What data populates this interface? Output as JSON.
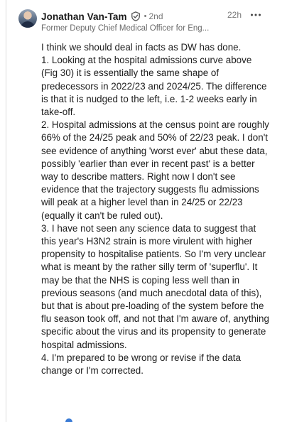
{
  "comment": {
    "author": "Jonathan Van-Tam",
    "verified_icon": "shield-check-icon",
    "connection_degree": "2nd",
    "separator": "•",
    "headline": "Former Deputy Chief Medical Officer for Eng...",
    "time": "22h",
    "more_icon": "three-dots-icon",
    "paragraphs": [
      "I think we should deal in facts as DW has done.",
      "1. Looking at the hospital admissions curve above (Fig 30) it is essentially the same shape of predecessors in 2022/23 and 2024/25. The difference is that it is nudged to the left, i.e. 1-2 weeks early in take-off.",
      "2. Hospital admissions at the census point are roughly 66% of the 24/25 peak and 50% of 22/23 peak. I don't see evidence of anything 'worst ever' abut these data, possibly 'earlier than ever in recent past' is a better way to describe matters. Right now I don't see evidence that the trajectory suggests flu admissions will peak at a higher level than in 24/25 or 22/23 (equally it can't be ruled out).",
      "3. I have not seen any science data to suggest that this year's H3N2 strain is more virulent with higher propensity to hospitalise patients. So I'm very unclear what is meant by the rather silly term of 'superflu'. It may be that the NHS is coping less well than in previous seasons (and much anecdotal data of this), but that is about pre-loading of the system before the flu season took off, and not that I'm aware of, anything specific about the virus and its propensity to generate hospital admissions.",
      "4. I'm prepared to be wrong or revise if the data change or I'm corrected."
    ]
  },
  "colors": {
    "text": "#1d1d1d",
    "muted": "#6a6a6a",
    "thread_line": "#dcdcdc",
    "reaction_blue": "#3a7bd5"
  }
}
